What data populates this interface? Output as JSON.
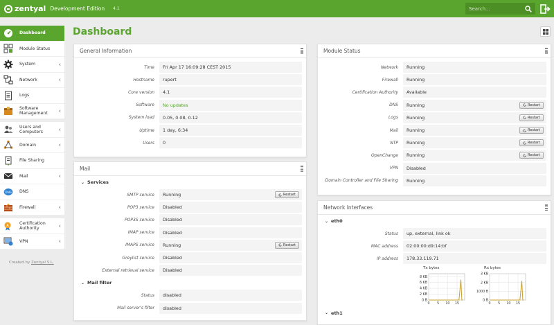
{
  "header": {
    "brand": "zentyal",
    "edition": "Development Edition",
    "version": "4.1",
    "search_placeholder": "Search..."
  },
  "sidebar": {
    "groups": [
      [
        {
          "label": "Dashboard",
          "icon": "dashboard-icon",
          "active": true
        },
        {
          "label": "Module Status",
          "icon": "module-status-icon"
        },
        {
          "label": "System",
          "icon": "gear-icon",
          "arrow": true
        },
        {
          "label": "Network",
          "icon": "network-icon",
          "arrow": true
        },
        {
          "label": "Logs",
          "icon": "logs-icon"
        },
        {
          "label": "Software Management",
          "icon": "software-icon",
          "arrow": true
        }
      ],
      [
        {
          "label": "Users and Computers",
          "icon": "users-icon",
          "arrow": true
        },
        {
          "label": "Domain",
          "icon": "domain-icon",
          "arrow": true
        },
        {
          "label": "File Sharing",
          "icon": "file-sharing-icon"
        },
        {
          "label": "Mail",
          "icon": "mail-icon",
          "arrow": true
        },
        {
          "label": "DNS",
          "icon": "dns-icon"
        },
        {
          "label": "Firewall",
          "icon": "firewall-icon",
          "arrow": true
        }
      ],
      [
        {
          "label": "Certification Authority",
          "icon": "certificate-icon",
          "arrow": true
        },
        {
          "label": "VPN",
          "icon": "vpn-icon",
          "arrow": true
        }
      ]
    ],
    "created_prefix": "Created by",
    "created_link": "Zentyal S.L."
  },
  "page_title": "Dashboard",
  "general": {
    "title": "General Information",
    "rows": [
      {
        "k": "Time",
        "v": "Fri Apr 17 16:09:28 CEST 2015"
      },
      {
        "k": "Hostname",
        "v": "rupert"
      },
      {
        "k": "Core version",
        "v": "4.1"
      },
      {
        "k": "Software",
        "v": "No updates",
        "ok": true
      },
      {
        "k": "System load",
        "v": "0.05, 0.08, 0.12"
      },
      {
        "k": "Uptime",
        "v": "1 day, 6:34"
      },
      {
        "k": "Users",
        "v": "0"
      }
    ]
  },
  "mail": {
    "title": "Mail",
    "services_label": "Services",
    "services": [
      {
        "k": "SMTP service",
        "v": "Running",
        "restart": true
      },
      {
        "k": "POP3 service",
        "v": "Disabled"
      },
      {
        "k": "POP3S service",
        "v": "Disabled"
      },
      {
        "k": "IMAP service",
        "v": "Disabled"
      },
      {
        "k": "IMAPS service",
        "v": "Running",
        "restart": true
      },
      {
        "k": "Greylist service",
        "v": "Disabled"
      },
      {
        "k": "External retrieval service",
        "v": "Disabled"
      }
    ],
    "filter_label": "Mail filter",
    "filter": [
      {
        "k": "Status",
        "v": "disabled"
      },
      {
        "k": "Mail server's filter",
        "v": "disabled"
      }
    ]
  },
  "module_status": {
    "title": "Module Status",
    "restart_label": "Restart",
    "rows": [
      {
        "k": "Network",
        "v": "Running"
      },
      {
        "k": "Firewall",
        "v": "Running"
      },
      {
        "k": "Certification Authority",
        "v": "Available"
      },
      {
        "k": "DNS",
        "v": "Running",
        "restart": true
      },
      {
        "k": "Logs",
        "v": "Running",
        "restart": true
      },
      {
        "k": "Mail",
        "v": "Running",
        "restart": true
      },
      {
        "k": "NTP",
        "v": "Running",
        "restart": true
      },
      {
        "k": "OpenChange",
        "v": "Running",
        "restart": true
      },
      {
        "k": "VPN",
        "v": "Disabled"
      },
      {
        "k": "Domain Controller and File Sharing",
        "v": "Running"
      }
    ]
  },
  "network": {
    "title": "Network Interfaces",
    "iface1": "eth0",
    "rows": [
      {
        "k": "Status",
        "v": "up, external, link ok"
      },
      {
        "k": "MAC address",
        "v": "02:00:00:d9:14:bf"
      },
      {
        "k": "IP address",
        "v": "178.33.119.71"
      }
    ],
    "iface2": "eth1"
  },
  "chart_data": [
    {
      "type": "line",
      "title": "Tx bytes",
      "x_ticks": [
        0,
        5,
        10,
        15
      ],
      "y_ticks": [
        "0 B",
        "2 KB",
        "4 KB",
        "6 KB",
        "8 KB"
      ],
      "xlim": [
        0,
        19
      ],
      "ylim": [
        0,
        9
      ],
      "color": "#c8a02a",
      "series": [
        {
          "x": [
            0,
            16,
            17,
            17.5,
            18
          ],
          "y": [
            0,
            0,
            7,
            0,
            0
          ]
        }
      ]
    },
    {
      "type": "line",
      "title": "Rx bytes",
      "x_ticks": [
        0,
        5,
        10,
        15
      ],
      "y_ticks": [
        "0 B",
        "1000 B",
        "2 KB",
        "3 KB"
      ],
      "xlim": [
        0,
        19
      ],
      "ylim": [
        0,
        3
      ],
      "color": "#c8a02a",
      "series": [
        {
          "x": [
            0,
            16,
            17,
            17.5,
            18
          ],
          "y": [
            0,
            0,
            2.2,
            0,
            0
          ]
        }
      ]
    }
  ]
}
